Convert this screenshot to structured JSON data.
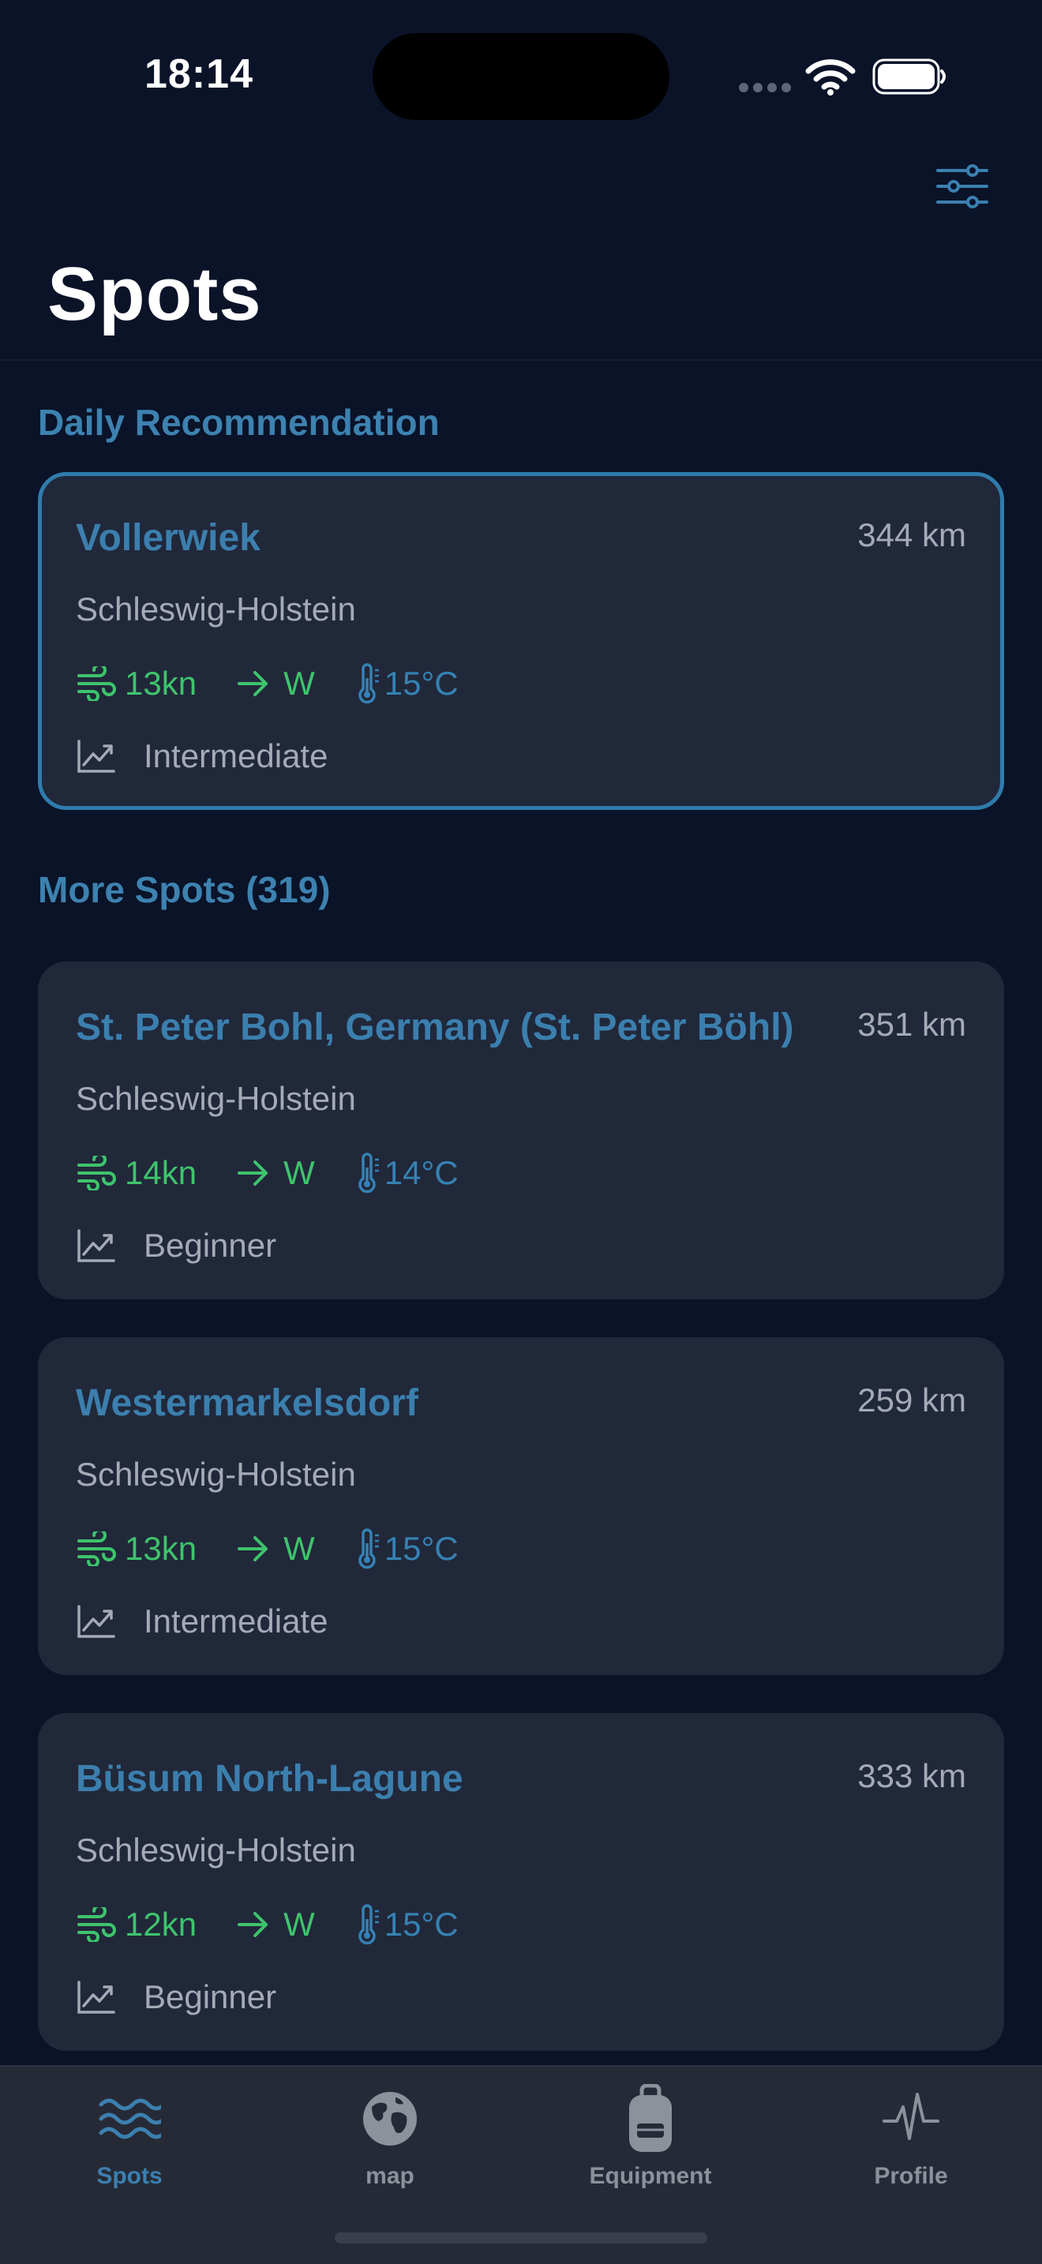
{
  "status_bar": {
    "time": "18:14"
  },
  "header": {
    "title": "Spots"
  },
  "sections": {
    "daily_title": "Daily Recommendation",
    "more_title": "More Spots (319)"
  },
  "featured": {
    "name": "Vollerwiek",
    "distance": "344 km",
    "region": "Schleswig-Holstein",
    "wind": "13kn",
    "direction": "W",
    "temp": "15°C",
    "level": "Intermediate"
  },
  "spots": [
    {
      "name": "St. Peter Bohl, Germany (St. Peter Böhl)",
      "distance": "351 km",
      "region": "Schleswig-Holstein",
      "wind": "14kn",
      "direction": "W",
      "temp": "14°C",
      "level": "Beginner"
    },
    {
      "name": "Westermarkelsdorf",
      "distance": "259 km",
      "region": "Schleswig-Holstein",
      "wind": "13kn",
      "direction": "W",
      "temp": "15°C",
      "level": "Intermediate"
    },
    {
      "name": "Büsum North-Lagune",
      "distance": "333 km",
      "region": "Schleswig-Holstein",
      "wind": "12kn",
      "direction": "W",
      "temp": "15°C",
      "level": "Beginner"
    }
  ],
  "tabs": [
    {
      "label": "Spots",
      "icon": "waves-icon",
      "active": true
    },
    {
      "label": "map",
      "icon": "globe-icon",
      "active": false
    },
    {
      "label": "Equipment",
      "icon": "backpack-icon",
      "active": false
    },
    {
      "label": "Profile",
      "icon": "heartbeat-icon",
      "active": false
    }
  ],
  "colors": {
    "background": "#0a1328",
    "card": "#21283a",
    "accent": "#3b7fae",
    "wind_green": "#3ec46c",
    "temp_blue": "#3582b4"
  }
}
